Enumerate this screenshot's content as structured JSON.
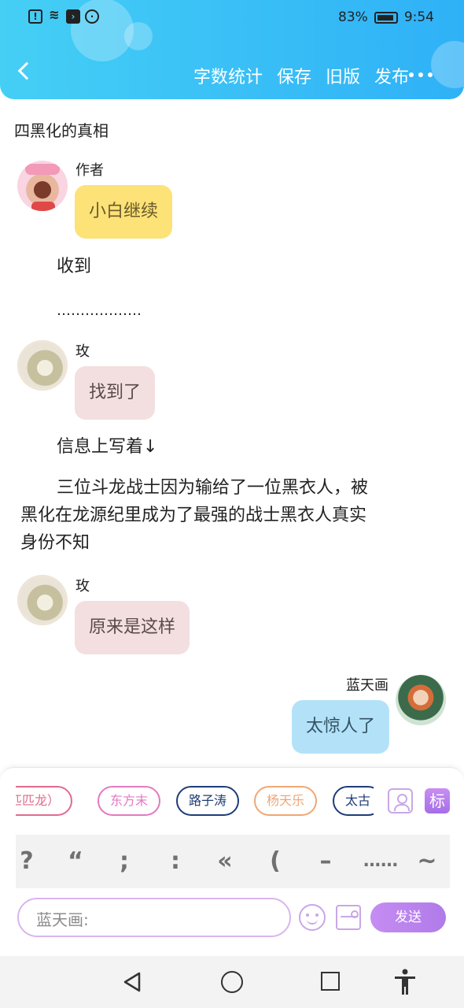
{
  "status_bar": {
    "battery_percent": "83%",
    "time": "9:54"
  },
  "header": {
    "actions": [
      "字数统计",
      "保存",
      "旧版",
      "发布"
    ],
    "back_icon": "chevron-left-icon",
    "more_icon": "more-dots-icon"
  },
  "document": {
    "title": "四黑化的真相"
  },
  "messages": [
    {
      "speaker": "作者",
      "text": "小白继续",
      "bubble_color": "#fce277"
    },
    {
      "speaker": "玫",
      "text": "找到了",
      "bubble_color": "#f3dfe0"
    },
    {
      "speaker": "玫",
      "text": "原来是这样",
      "bubble_color": "#f3dfe0"
    },
    {
      "speaker": "蓝天画",
      "text": "太惊人了",
      "bubble_color": "#b3e2f8"
    }
  ],
  "narration": {
    "line1": "收到",
    "line2": "………………",
    "line3": "信息上写着↓",
    "line4a": "三位斗龙战士因为输给了一位黑衣人，被",
    "line4b": "黑化在龙源纪里成为了最强的战士黑衣人真实",
    "line4c": "身份不知"
  },
  "character_chips": [
    "匹匹龙）",
    "东方末",
    "路子涛",
    "杨天乐",
    "太古"
  ],
  "tag_button": "标",
  "punctuation": [
    "?",
    "“",
    ";",
    ":",
    "«",
    "(",
    "–",
    "……",
    "~"
  ],
  "input": {
    "placeholder": "蓝天画:"
  },
  "send_button": "发送",
  "colors": {
    "header_start": "#45cff5",
    "header_end": "#2fb1f7",
    "accent_purple": "#b07ae9"
  }
}
